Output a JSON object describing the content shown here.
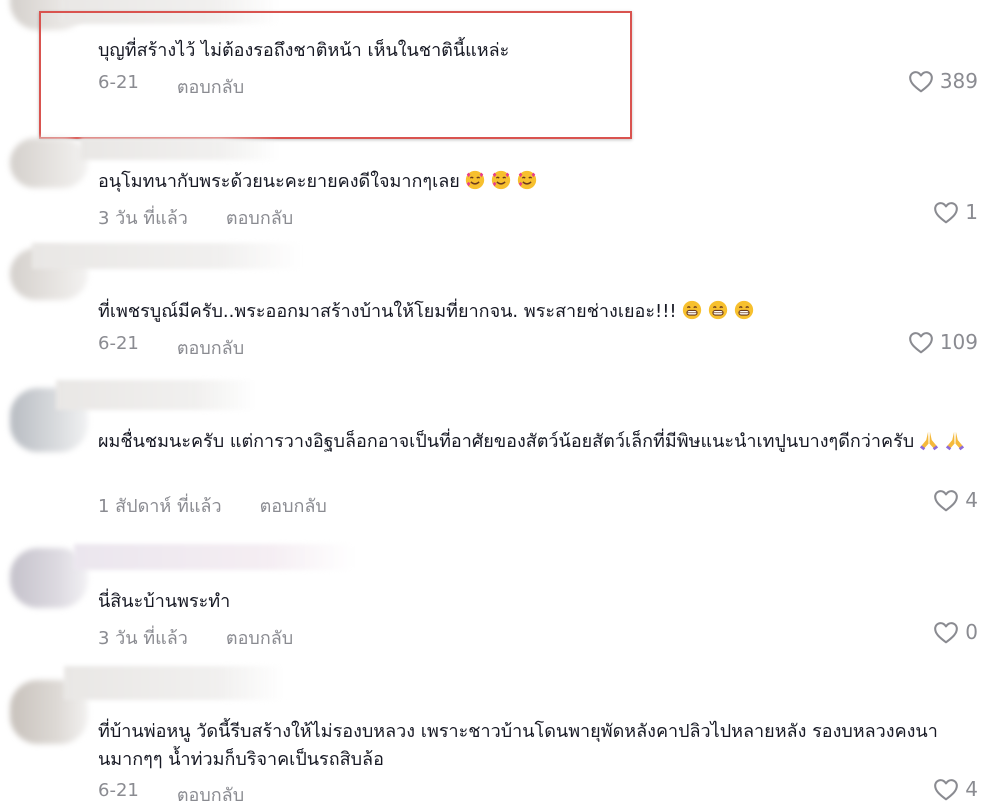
{
  "comments": [
    {
      "text": "บุญที่สร้างไว้ ไม่ต้องรอถึงชาติหน้า เห็นในชาตินี้แหล่ะ",
      "date": "6-21",
      "reply_label": "ตอบกลับ",
      "likes": "389"
    },
    {
      "text": "อนุโมทนากับพระด้วยนะคะยายคงดีใจมากๆเลย",
      "emoji": [
        "smiling-face-with-hearts-icon",
        "smiling-face-with-hearts-icon",
        "smiling-face-with-hearts-icon"
      ],
      "date": "3 วัน ที่แล้ว",
      "reply_label": "ตอบกลับ",
      "likes": "1"
    },
    {
      "text": "ที่เพชรบูณ์มีครับ..พระออกมาสร้างบ้านให้โยมที่ยากจน. พระสายช่างเยอะ!!!",
      "emoji": [
        "grinning-face-icon",
        "grinning-face-icon",
        "grinning-face-icon"
      ],
      "date": "6-21",
      "reply_label": "ตอบกลับ",
      "likes": "109"
    },
    {
      "text": "ผมชื่นชมนะครับ แต่การวางอิฐบล็อกอาจเป็นที่อาศัยของสัตว์น้อยสัตว์เล็กที่มีพิษแนะนำเทปูนบางๆดีกว่าครับ",
      "emoji": [
        "folded-hands-icon",
        "folded-hands-icon"
      ],
      "date": "1 สัปดาห์ ที่แล้ว",
      "reply_label": "ตอบกลับ",
      "likes": "4"
    },
    {
      "text": "นี่สินะบ้านพระทำ",
      "date": "3 วัน ที่แล้ว",
      "reply_label": "ตอบกลับ",
      "likes": "0"
    },
    {
      "text": "ที่บ้านพ่อหนู วัดนี้รีบสร้างให้ไม่รองบหลวง เพราะชาวบ้านโดนพายุพัดหลังคาปลิวไปหลายหลัง รองบหลวงคงนานมากๆๆ น้ำท่วมก็บริจาคเป็นรถสิบล้อ",
      "date": "6-21",
      "reply_label": "ตอบกลับ",
      "likes": "4"
    }
  ],
  "colors": {
    "text": "#161823",
    "meta": "#8a8b91",
    "highlight_border": "#d9534f"
  }
}
